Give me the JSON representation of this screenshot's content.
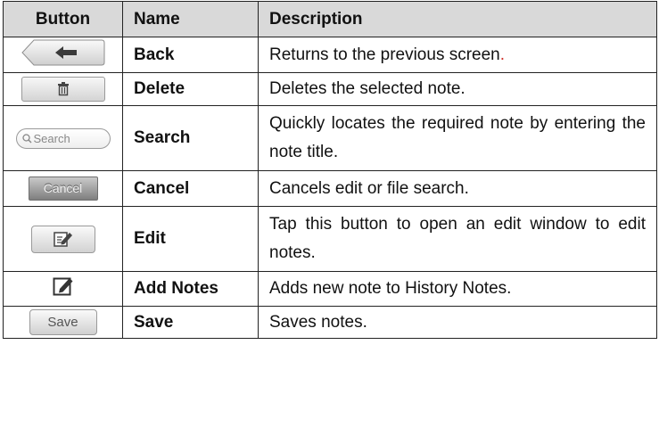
{
  "table": {
    "headers": [
      "Button",
      "Name",
      "Description"
    ],
    "rows": [
      {
        "icon": "back-arrow-icon",
        "name": "Back",
        "description": "Returns to the previous screen",
        "description_suffix": "."
      },
      {
        "icon": "trash-icon",
        "name": "Delete",
        "description": "Deletes the selected note."
      },
      {
        "icon": "search-field-icon",
        "icon_label": "Search",
        "name": "Search",
        "description": "Quickly locates the required note by entering the note title."
      },
      {
        "icon": "cancel-button-icon",
        "icon_label": "Cancel",
        "name": "Cancel",
        "description": "Cancels edit or file search."
      },
      {
        "icon": "edit-icon",
        "name": "Edit",
        "description": "Tap this button to open an edit window to edit notes."
      },
      {
        "icon": "add-note-icon",
        "name": "Add Notes",
        "description": "Adds new note to History Notes."
      },
      {
        "icon": "save-button-icon",
        "icon_label": "Save",
        "name": "Save",
        "description": "Saves notes."
      }
    ]
  },
  "colors": {
    "header_bg": "#d9d9d9",
    "accent_red": "#d0322a",
    "border": "#222222"
  }
}
